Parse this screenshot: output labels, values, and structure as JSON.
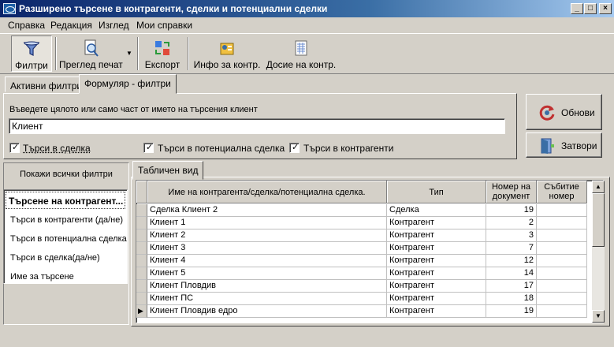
{
  "window": {
    "title": "Разширено търсене в контрагенти, сделки и потенциални сделки",
    "minimize": "_",
    "maximize": "□",
    "close": "×"
  },
  "menu": [
    "Справка",
    "Редакция",
    "Изглед",
    "Мои справки"
  ],
  "toolbar": {
    "filters": "Филтри",
    "print_preview": "Преглед печат",
    "export": "Експорт",
    "contractor_info": "Инфо за контр.",
    "contractor_dossier": "Досие на контр."
  },
  "tabs": {
    "active_filters": "Активни филтри",
    "filter_form": "Формуляр - филтри"
  },
  "form": {
    "prompt": "Въведете цялото или само част от името на търсения клиент",
    "search_value": "Клиент",
    "checkboxes": [
      {
        "label": "Търси в сделка",
        "checked": true
      },
      {
        "label": "Търси в потенциална сделка",
        "checked": true
      },
      {
        "label": "Търси в контрагенти",
        "checked": true
      }
    ]
  },
  "buttons": {
    "refresh": "Обнови",
    "close": "Затвори"
  },
  "left_panel": {
    "show_all": "Покажи всички филтри",
    "items": [
      "Търсене на контрагент...",
      "Търси в контрагенти (да/не)",
      "Търси в потенциална сделка",
      "Търси в сделка(да/не)",
      "Име за търсене"
    ]
  },
  "grid_tab": "Табличен вид",
  "grid": {
    "headers": {
      "name": "Име на контрагента/сделка/потенциална сделка.",
      "type": "Тип",
      "doc_no_1": "Номер на",
      "doc_no_2": "документ",
      "event_no_1": "Събитие",
      "event_no_2": "номер"
    },
    "rows": [
      {
        "name": "Сделка Клиент 2",
        "type": "Сделка",
        "doc": "19",
        "event": ""
      },
      {
        "name": "Клиент 1",
        "type": "Контрагент",
        "doc": "2",
        "event": ""
      },
      {
        "name": "Клиент 2",
        "type": "Контрагент",
        "doc": "3",
        "event": ""
      },
      {
        "name": "Клиент 3",
        "type": "Контрагент",
        "doc": "7",
        "event": ""
      },
      {
        "name": "Клиент 4",
        "type": "Контрагент",
        "doc": "12",
        "event": ""
      },
      {
        "name": "Клиент 5",
        "type": "Контрагент",
        "doc": "14",
        "event": ""
      },
      {
        "name": "Клиент Пловдив",
        "type": "Контрагент",
        "doc": "17",
        "event": ""
      },
      {
        "name": "Клиент ПС",
        "type": "Контрагент",
        "doc": "18",
        "event": ""
      },
      {
        "name": "Клиент Пловдив едро",
        "type": "Контрагент",
        "doc": "19",
        "event": "",
        "current": true
      }
    ]
  }
}
